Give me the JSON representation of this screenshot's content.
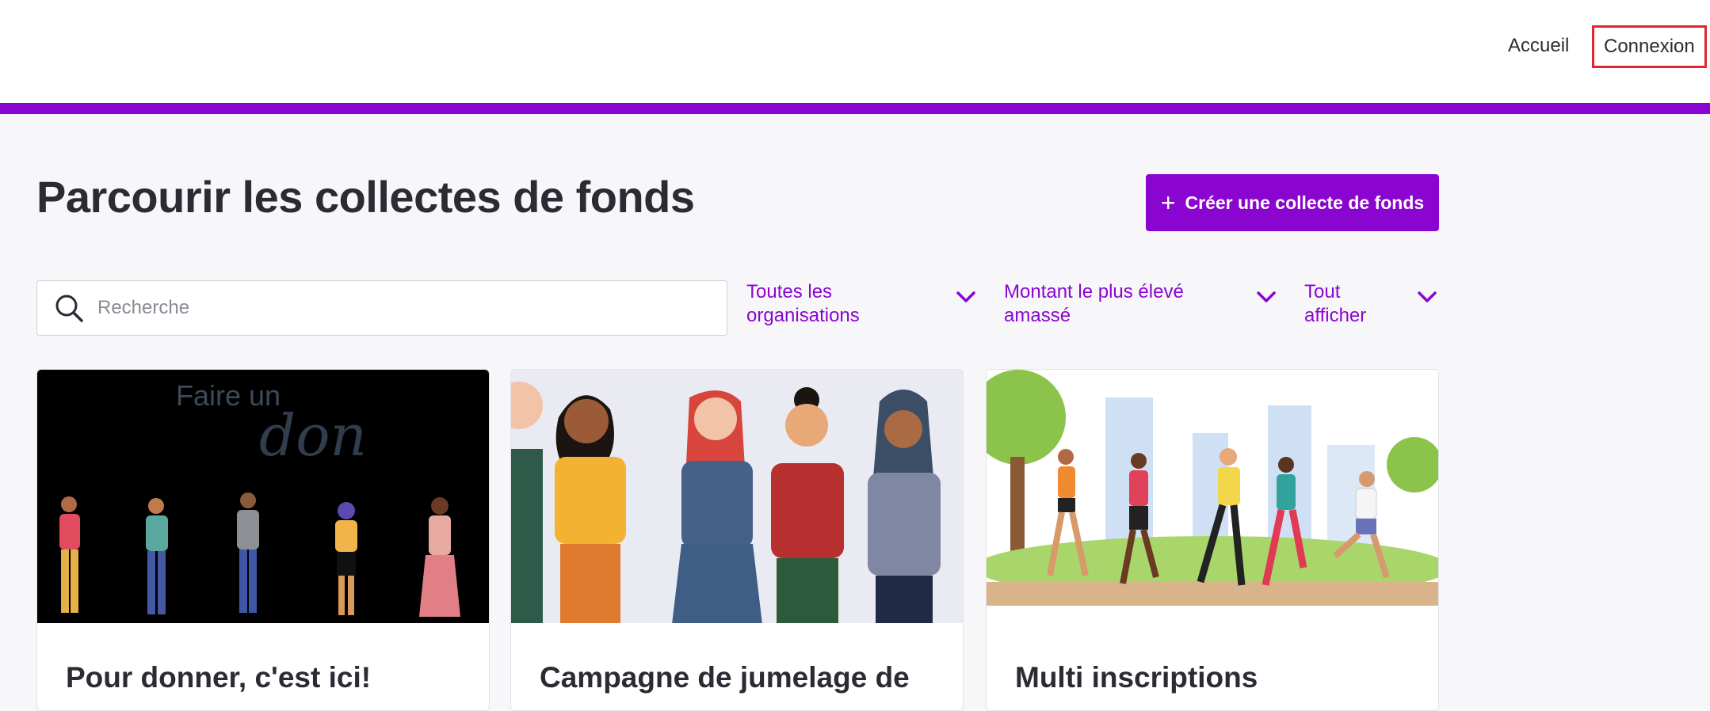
{
  "header": {
    "nav": {
      "home_label": "Accueil",
      "login_label": "Connexion"
    },
    "accent_color": "#8a06d0"
  },
  "main": {
    "title": "Parcourir les collectes de fonds",
    "create_button_label": "Créer une collecte de fonds",
    "search": {
      "placeholder": "Recherche",
      "value": ""
    },
    "filters": {
      "organization": "Toutes les organisations",
      "sort": "Montant le plus élevé amassé",
      "display": "Tout afficher"
    },
    "cards": [
      {
        "title": "Pour donner, c'est ici!",
        "image_text": "Faire un",
        "image_script": "don"
      },
      {
        "title": "Campagne de jumelage de"
      },
      {
        "title": "Multi inscriptions"
      }
    ]
  }
}
